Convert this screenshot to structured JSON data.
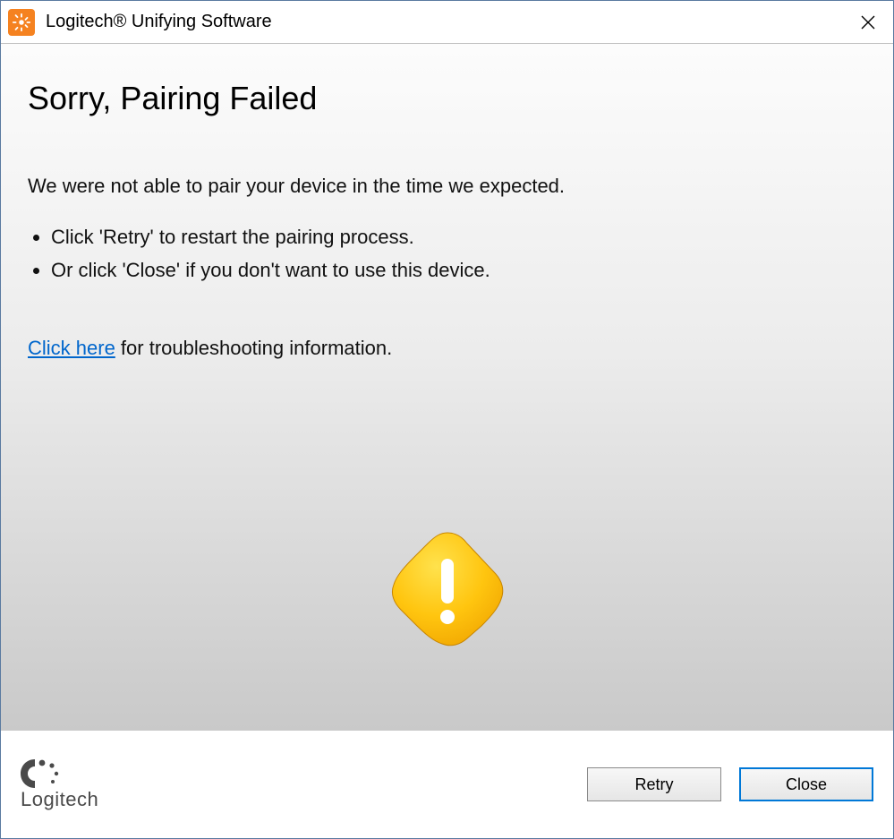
{
  "titlebar": {
    "title": "Logitech® Unifying Software"
  },
  "main": {
    "heading": "Sorry, Pairing Failed",
    "intro": "We were not able to pair your device in the time we expected.",
    "bullets": [
      "Click 'Retry' to restart the pairing process.",
      "Or click 'Close' if you don't want to use this device."
    ],
    "troubleshoot_link": "Click here",
    "troubleshoot_rest": " for troubleshooting information."
  },
  "footer": {
    "brand": "Logitech",
    "retry_label": "Retry",
    "close_label": "Close"
  }
}
